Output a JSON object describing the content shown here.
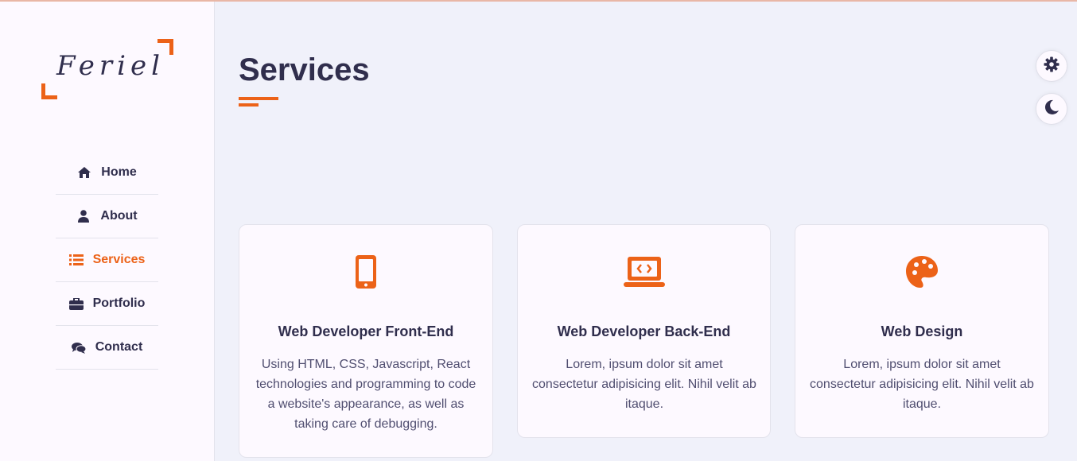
{
  "brand": {
    "logo_text": "Feriel"
  },
  "nav": {
    "items": [
      {
        "label": "Home",
        "icon": "home-icon"
      },
      {
        "label": "About",
        "icon": "user-icon"
      },
      {
        "label": "Services",
        "icon": "list-icon",
        "active": true
      },
      {
        "label": "Portfolio",
        "icon": "briefcase-icon"
      },
      {
        "label": "Contact",
        "icon": "comments-icon"
      }
    ]
  },
  "page": {
    "title": "Services"
  },
  "controls": {
    "settings_icon": "gear-icon",
    "theme_icon": "moon-icon"
  },
  "services": [
    {
      "icon": "mobile-icon",
      "title": "Web Developer Front-End",
      "description": "Using HTML, CSS, Javascript, React technologies and programming to code a website's appearance, as well as taking care of debugging."
    },
    {
      "icon": "laptop-code-icon",
      "title": "Web Developer Back-End",
      "description": "Lorem, ipsum dolor sit amet consectetur adipisicing elit. Nihil velit ab itaque."
    },
    {
      "icon": "palette-icon",
      "title": "Web Design",
      "description": "Lorem, ipsum dolor sit amet consectetur adipisicing elit. Nihil velit ab itaque."
    }
  ],
  "colors": {
    "accent": "#ec6218",
    "text": "#302e4d",
    "background": "#f0f1fa",
    "card": "#fdf9ff"
  }
}
